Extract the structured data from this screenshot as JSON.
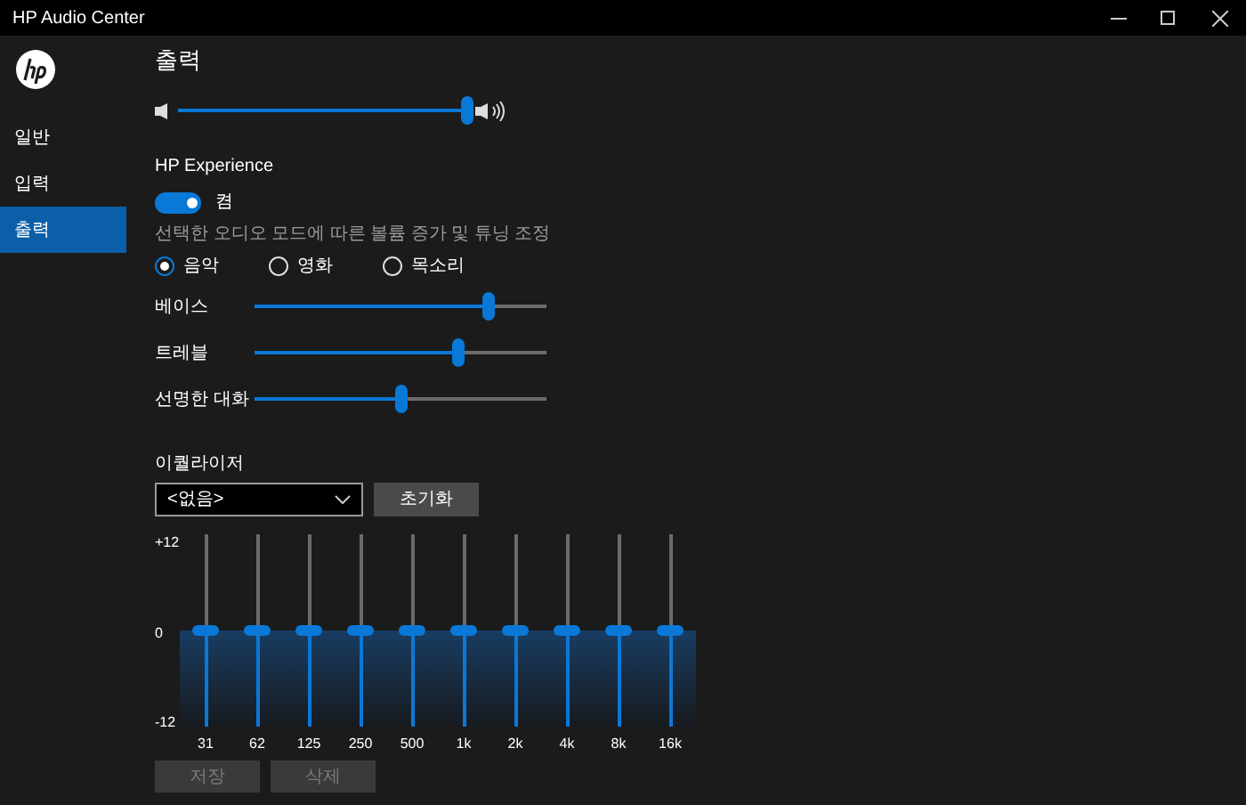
{
  "window": {
    "title": "HP Audio Center"
  },
  "sidebar": {
    "items": [
      {
        "label": "일반",
        "selected": false
      },
      {
        "label": "입력",
        "selected": false
      },
      {
        "label": "출력",
        "selected": true
      }
    ]
  },
  "page_title": "출력",
  "volume": {
    "level": 1.0
  },
  "experience": {
    "title": "HP Experience",
    "toggle": {
      "on": true,
      "label": "켬"
    },
    "description": "선택한 오디오 모드에 따른 볼륨 증가 및 튜닝 조정",
    "modes": [
      {
        "label": "음악",
        "selected": true
      },
      {
        "label": "영화",
        "selected": false
      },
      {
        "label": "목소리",
        "selected": false
      }
    ],
    "sliders": [
      {
        "label": "베이스",
        "level": 0.8
      },
      {
        "label": "트레블",
        "level": 0.7
      },
      {
        "label": "선명한 대화",
        "level": 0.5
      }
    ]
  },
  "equalizer": {
    "title": "이퀄라이저",
    "preset": "<없음>",
    "reset_button": "초기화",
    "scale": [
      "+12",
      "0",
      "-12"
    ],
    "bands": [
      {
        "label": "31",
        "level": 0.5
      },
      {
        "label": "62",
        "level": 0.5
      },
      {
        "label": "125",
        "level": 0.5
      },
      {
        "label": "250",
        "level": 0.5
      },
      {
        "label": "500",
        "level": 0.5
      },
      {
        "label": "1k",
        "level": 0.5
      },
      {
        "label": "2k",
        "level": 0.5
      },
      {
        "label": "4k",
        "level": 0.5
      },
      {
        "label": "8k",
        "level": 0.5
      },
      {
        "label": "16k",
        "level": 0.5
      }
    ],
    "buttons": [
      {
        "label": "저장",
        "disabled": true
      },
      {
        "label": "삭제",
        "disabled": true
      }
    ]
  }
}
